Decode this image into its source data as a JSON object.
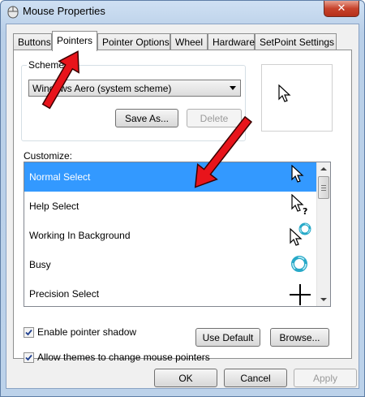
{
  "window": {
    "title": "Mouse Properties",
    "close_glyph": "✕"
  },
  "tabs": [
    "Buttons",
    "Pointers",
    "Pointer Options",
    "Wheel",
    "Hardware",
    "SetPoint Settings"
  ],
  "active_tab": "Pointers",
  "scheme": {
    "group_label": "Scheme",
    "selected": "Windows Aero (system scheme)",
    "save_as_label": "Save As...",
    "delete_label": "Delete"
  },
  "customize": {
    "label": "Customize:",
    "items": [
      {
        "label": "Normal Select",
        "icon": "arrow-cursor-icon",
        "selected": true
      },
      {
        "label": "Help Select",
        "icon": "help-cursor-icon",
        "selected": false
      },
      {
        "label": "Working In Background",
        "icon": "working-cursor-icon",
        "selected": false
      },
      {
        "label": "Busy",
        "icon": "busy-cursor-icon",
        "selected": false
      },
      {
        "label": "Precision Select",
        "icon": "crosshair-cursor-icon",
        "selected": false
      }
    ]
  },
  "options": {
    "shadow_label": "Enable pointer shadow",
    "shadow_checked": true,
    "use_default_label": "Use Default",
    "browse_label": "Browse...",
    "themes_label": "Allow themes to change mouse pointers",
    "themes_checked": true
  },
  "footer": {
    "ok_label": "OK",
    "cancel_label": "Cancel",
    "apply_label": "Apply"
  },
  "colors": {
    "selection": "#3399ff",
    "annotation_arrow": "#e8141b"
  }
}
